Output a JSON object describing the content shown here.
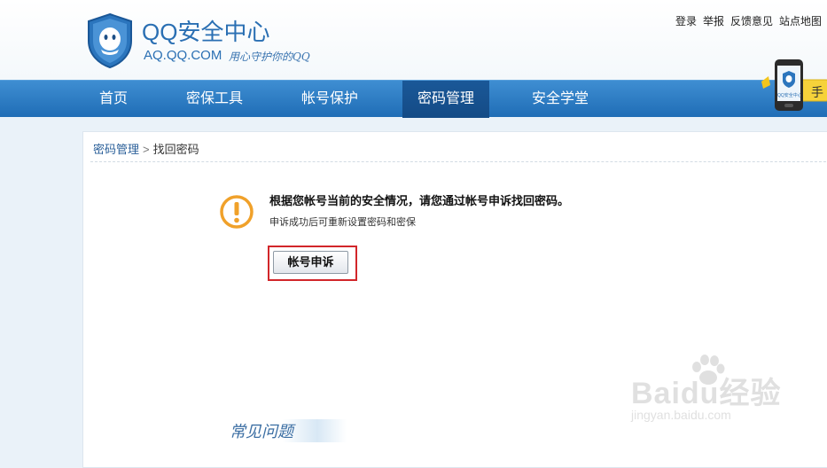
{
  "brand": {
    "title": "QQ安全中心",
    "domain": "AQ.QQ.COM",
    "slogan": "用心守护你的QQ"
  },
  "top_links": [
    "登录",
    "举报",
    "反馈意见",
    "站点地图"
  ],
  "nav": {
    "items": [
      "首页",
      "密保工具",
      "帐号保护",
      "密码管理",
      "安全学堂"
    ],
    "active_index": 3
  },
  "promo": {
    "phone_screen_text": "QQ安全中心",
    "tab_text": "手"
  },
  "breadcrumb": {
    "parent": "密码管理",
    "separator": ">",
    "current": "找回密码"
  },
  "message": {
    "main": "根据您帐号当前的安全情况，请您通过帐号申诉找回密码。",
    "sub": "申诉成功后可重新设置密码和密保"
  },
  "appeal_button_label": "帐号申诉",
  "faq_title": "常见问题",
  "watermark": {
    "logo": "Baidu经验",
    "url": "jingyan.baidu.com"
  },
  "colors": {
    "brand_blue": "#2a6fb3",
    "nav_blue": "#2f7ec5",
    "nav_active": "#174f8c",
    "warning_orange": "#f0a12a",
    "highlight_red": "#d2262a"
  }
}
